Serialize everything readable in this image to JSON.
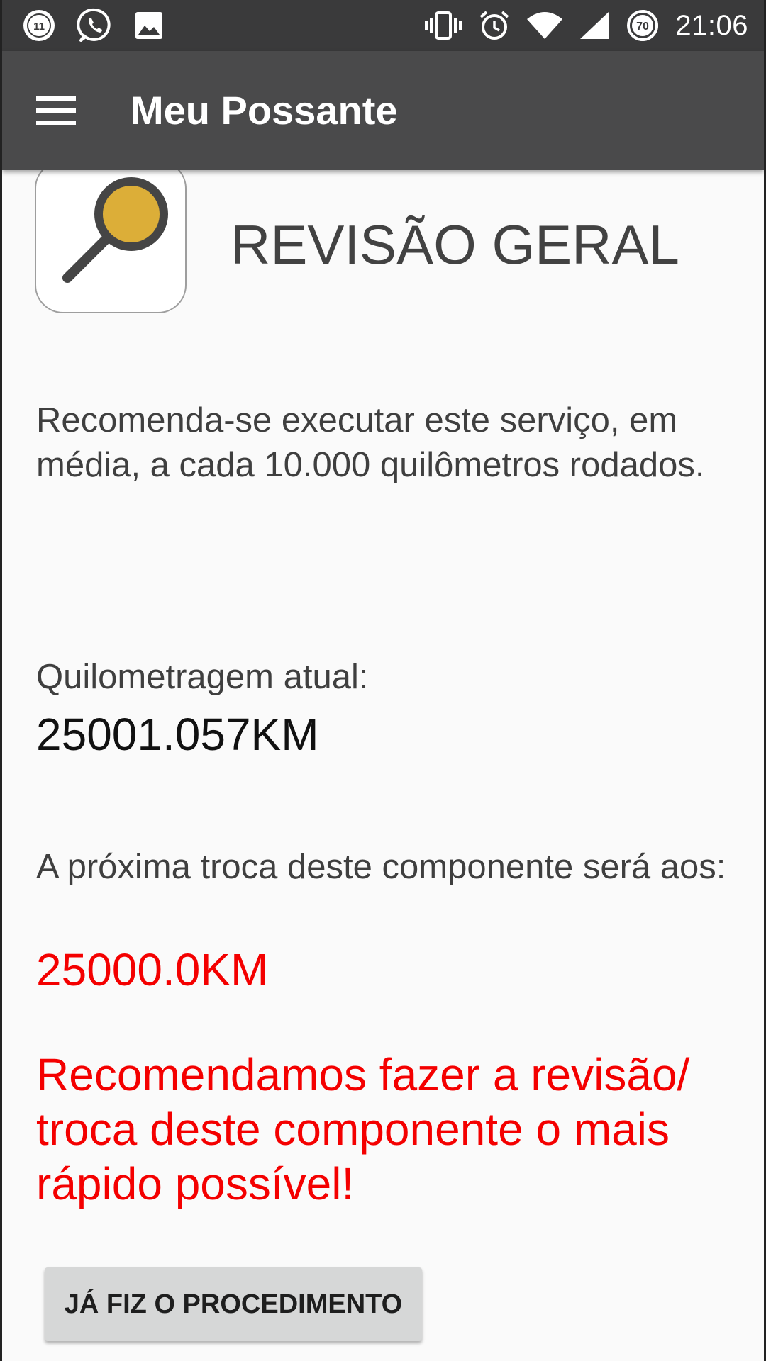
{
  "status_bar": {
    "notification_badge": "11",
    "battery_level": "70",
    "time": "21:06",
    "left_icons": [
      "notification-count-icon",
      "whatsapp-icon",
      "image-icon"
    ],
    "right_icons": [
      "vibrate-icon",
      "alarm-icon",
      "wifi-icon",
      "signal-icon",
      "battery-icon"
    ]
  },
  "app_bar": {
    "title": "Meu Possante",
    "menu_icon": "hamburger-menu-icon",
    "background": "#4a4a4b"
  },
  "service": {
    "icon": "magnifier-icon",
    "title": "REVISÃO GERAL",
    "description": "Recomenda-se executar este serviço, em média, a cada 10.000 quilômetros rodados.",
    "current_km_label": "Quilometragem atual:",
    "current_km_value": "25001.057KM",
    "next_change_label": "A próxima troca deste componente será aos:",
    "next_change_value": "25000.0KM",
    "warning": "Recomendamos fazer a revisão/ troca deste componente o mais rápido possível!"
  },
  "actions": {
    "done_button": "JÁ FIZ O PROCEDIMENTO"
  },
  "colors": {
    "warning": "#f40000",
    "icon_accent": "#dcae38",
    "status_bar": "#3a3a3b"
  }
}
